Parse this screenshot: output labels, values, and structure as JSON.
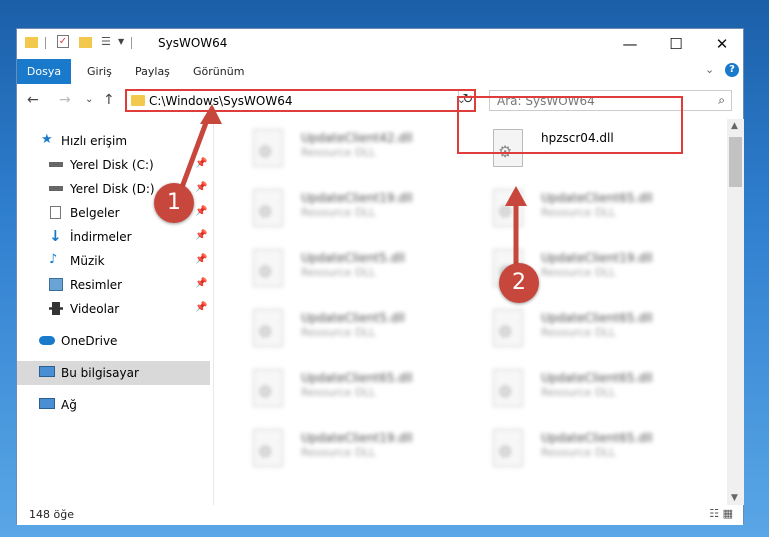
{
  "window": {
    "title": "SysWOW64",
    "controls": {
      "minimize": "—",
      "maximize": "☐",
      "close": "✕"
    }
  },
  "ribbon": {
    "tabs": [
      "Dosya",
      "Giriş",
      "Paylaş",
      "Görünüm"
    ],
    "collapse": "⌄",
    "help": "?"
  },
  "address": {
    "path": "C:\\Windows\\SysWOW64",
    "dropdown": "⌄",
    "refresh": "↻"
  },
  "nav": {
    "back": "←",
    "forward": "→",
    "recent": "⌄",
    "up": "↑"
  },
  "search": {
    "placeholder": "Ara: SysWOW64",
    "icon": "⌕"
  },
  "sidebar": {
    "items": [
      {
        "label": "Hızlı erişim",
        "icon": "star-icon",
        "pinned": false
      },
      {
        "label": "Yerel Disk (C:)",
        "icon": "drive-icon",
        "pinned": true
      },
      {
        "label": "Yerel Disk (D:)",
        "icon": "drive-icon",
        "pinned": true
      },
      {
        "label": "Belgeler",
        "icon": "documents-icon",
        "pinned": true
      },
      {
        "label": "İndirmeler",
        "icon": "download-icon",
        "pinned": true
      },
      {
        "label": "Müzik",
        "icon": "music-icon",
        "pinned": true
      },
      {
        "label": "Resimler",
        "icon": "pictures-icon",
        "pinned": true
      },
      {
        "label": "Videolar",
        "icon": "video-icon",
        "pinned": true
      },
      {
        "label": "OneDrive",
        "icon": "cloud-icon",
        "pinned": false
      },
      {
        "label": "Bu bilgisayar",
        "icon": "computer-icon",
        "pinned": false,
        "selected": true
      },
      {
        "label": "Ağ",
        "icon": "network-icon",
        "pinned": false
      }
    ],
    "pin_glyph": "📌"
  },
  "files": {
    "left": [
      {
        "name": "UpdateClient42.dll",
        "type": "Resource DLL"
      },
      {
        "name": "UpdateClient19.dll",
        "type": "Resource DLL"
      },
      {
        "name": "UpdateClient5.dll",
        "type": "Resource DLL"
      },
      {
        "name": "UpdateClient5.dll",
        "type": "Resource DLL"
      },
      {
        "name": "UpdateClient65.dll",
        "type": "Resource DLL"
      },
      {
        "name": "UpdateClient19.dll",
        "type": "Resource DLL"
      }
    ],
    "right": [
      {
        "name": "hpzscr04.dll",
        "type": ""
      },
      {
        "name": "UpdateClient65.dll",
        "type": "Resource DLL"
      },
      {
        "name": "UpdateClient19.dll",
        "type": "Resource DLL"
      },
      {
        "name": "UpdateClient65.dll",
        "type": "Resource DLL"
      },
      {
        "name": "UpdateClient65.dll",
        "type": "Resource DLL"
      },
      {
        "name": "UpdateClient65.dll",
        "type": "Resource DLL"
      }
    ]
  },
  "status": {
    "count": "148 öğe"
  },
  "callouts": {
    "one": "1",
    "two": "2"
  },
  "colors": {
    "accent": "#1979ca",
    "highlight": "#e03c3c",
    "badge": "#c7473c"
  }
}
